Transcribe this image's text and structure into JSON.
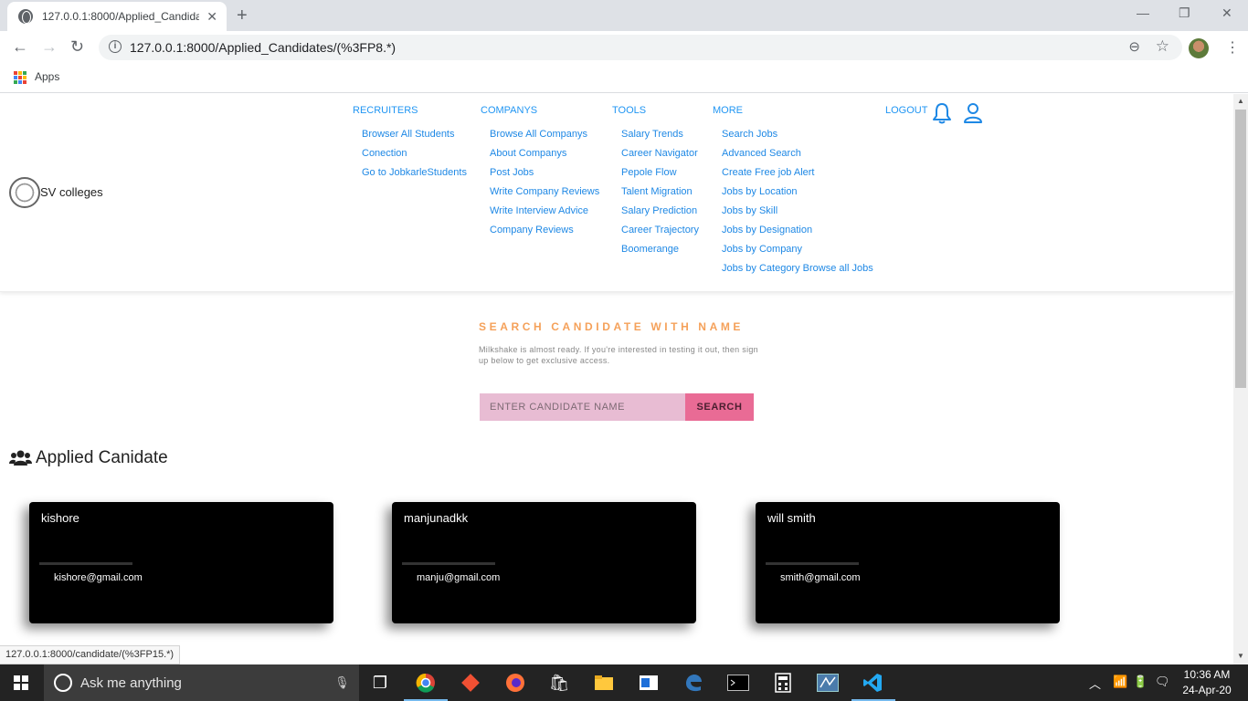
{
  "browser": {
    "tab_title": "127.0.0.1:8000/Applied_Candidat",
    "tab_close": "✕",
    "new_tab": "+",
    "url": "127.0.0.1:8000/Applied_Candidates/(%3FP8.*)",
    "bookmarks_apps": "Apps",
    "status_url": "127.0.0.1:8000/candidate/(%3FP15.*)"
  },
  "site": {
    "brand": "SV colleges",
    "nav": [
      {
        "heading": "RECRUITERS",
        "links": [
          "Browser All Students",
          "Conection",
          "Go to JobkarleStudents"
        ]
      },
      {
        "heading": "COMPANYS",
        "links": [
          "Browse All Companys",
          "About Companys",
          "Post Jobs",
          "Write Company Reviews",
          "Write Interview Advice",
          "Company Reviews"
        ]
      },
      {
        "heading": "TOOLS",
        "links": [
          "Salary Trends",
          "Career Navigator",
          "Pepole Flow",
          "Talent Migration",
          "Salary Prediction",
          "Career Trajectory",
          "Boomerange"
        ]
      },
      {
        "heading": "MORE",
        "links": [
          "Search Jobs",
          "Advanced Search",
          "Create Free job Alert",
          "Jobs by Location",
          "Jobs by Skill",
          "Jobs by Designation",
          "Jobs by Company",
          "Jobs by Category Browse all Jobs"
        ]
      }
    ],
    "logout": "LOGOUT"
  },
  "search": {
    "title": "SEARCH CANDIDATE WITH NAME",
    "description": "Milkshake is almost ready. If you're interested in testing it out, then sign up below to get exclusive access.",
    "placeholder": "ENTER CANDIDATE NAME",
    "button": "SEARCH"
  },
  "applied": {
    "title": "Applied Canidate",
    "candidates": [
      {
        "name": "kishore",
        "email": "kishore@gmail.com"
      },
      {
        "name": "manjunadkk",
        "email": "manju@gmail.com"
      },
      {
        "name": "will smith",
        "email": "smith@gmail.com"
      }
    ]
  },
  "taskbar": {
    "search_placeholder": "Ask me anything",
    "time": "10:36 AM",
    "date": "24-Apr-20"
  },
  "colors": {
    "accent_blue": "#2196f3",
    "title_orange": "#f5a15a",
    "search_input_bg": "#e8bcd3",
    "search_button_bg": "#e96b95",
    "card_bg": "#000000"
  }
}
